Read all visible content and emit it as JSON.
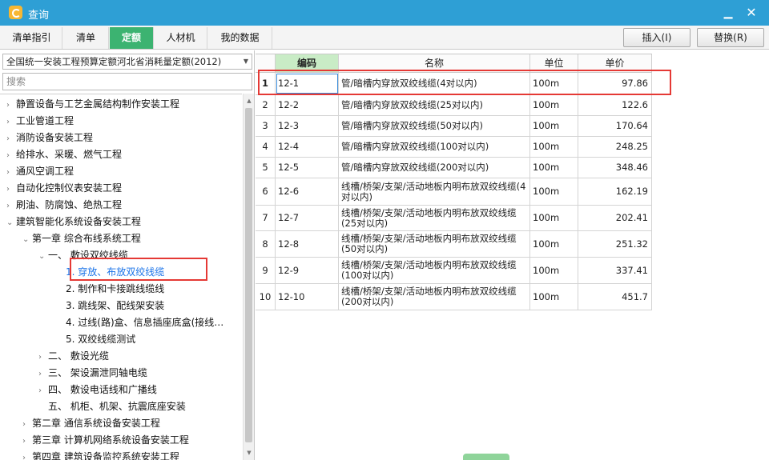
{
  "window": {
    "title": "查询"
  },
  "tabs": [
    {
      "label": "清单指引",
      "active": false
    },
    {
      "label": "清单",
      "active": false
    },
    {
      "label": "定额",
      "active": true
    },
    {
      "label": "人材机",
      "active": false
    },
    {
      "label": "我的数据",
      "active": false
    }
  ],
  "toolbar": {
    "insert_label": "插入(I)",
    "replace_label": "替换(R)"
  },
  "left": {
    "quota_book": "全国统一安装工程预算定额河北省消耗量定额(2012)",
    "search_placeholder": "搜索",
    "tree": [
      {
        "label": "静置设备与工艺金属结构制作安装工程",
        "toggle": "›"
      },
      {
        "label": "工业管道工程",
        "toggle": "›"
      },
      {
        "label": "消防设备安装工程",
        "toggle": "›"
      },
      {
        "label": "给排水、采暖、燃气工程",
        "toggle": "›"
      },
      {
        "label": "通风空调工程",
        "toggle": "›"
      },
      {
        "label": "自动化控制仪表安装工程",
        "toggle": "›"
      },
      {
        "label": "刷油、防腐蚀、绝热工程",
        "toggle": "›"
      },
      {
        "label": "建筑智能化系统设备安装工程",
        "toggle": "⌄"
      },
      {
        "label": "第一章 综合布线系统工程",
        "toggle": "⌄"
      },
      {
        "label": "一、 敷设双绞线缆",
        "toggle": "⌄"
      },
      {
        "label": "1. 穿放、布放双绞线缆",
        "toggle": "",
        "selected": true
      },
      {
        "label": "2. 制作和卡接跳线缆线",
        "toggle": ""
      },
      {
        "label": "3. 跳线架、配线架安装",
        "toggle": ""
      },
      {
        "label": "4. 过线(路)盒、信息插座底盒(接线…",
        "toggle": ""
      },
      {
        "label": "5. 双绞线缆测试",
        "toggle": ""
      },
      {
        "label": "二、 敷设光缆",
        "toggle": "›"
      },
      {
        "label": "三、 架设漏泄同轴电缆",
        "toggle": "›"
      },
      {
        "label": "四、 敷设电话线和广播线",
        "toggle": "›"
      },
      {
        "label": "五、 机柜、机架、抗震底座安装",
        "toggle": ""
      },
      {
        "label": "第二章 通信系统设备安装工程",
        "toggle": "›"
      },
      {
        "label": "第三章 计算机网络系统设备安装工程",
        "toggle": "›"
      },
      {
        "label": "第四章 建筑设备监控系统安装工程",
        "toggle": "›"
      }
    ]
  },
  "grid": {
    "headers": {
      "code": "编码",
      "name": "名称",
      "unit": "单位",
      "price": "单价"
    },
    "rows": [
      {
        "num": "1",
        "code": "12-1",
        "name": "管/暗槽内穿放双绞线缆(4对以内)",
        "unit": "100m",
        "price": "97.86"
      },
      {
        "num": "2",
        "code": "12-2",
        "name": "管/暗槽内穿放双绞线缆(25对以内)",
        "unit": "100m",
        "price": "122.6"
      },
      {
        "num": "3",
        "code": "12-3",
        "name": "管/暗槽内穿放双绞线缆(50对以内)",
        "unit": "100m",
        "price": "170.64"
      },
      {
        "num": "4",
        "code": "12-4",
        "name": "管/暗槽内穿放双绞线缆(100对以内)",
        "unit": "100m",
        "price": "248.25"
      },
      {
        "num": "5",
        "code": "12-5",
        "name": "管/暗槽内穿放双绞线缆(200对以内)",
        "unit": "100m",
        "price": "348.46"
      },
      {
        "num": "6",
        "code": "12-6",
        "name": "线槽/桥架/支架/活动地板内明布放双绞线缆(4对以内)",
        "unit": "100m",
        "price": "162.19"
      },
      {
        "num": "7",
        "code": "12-7",
        "name": "线槽/桥架/支架/活动地板内明布放双绞线缆(25对以内)",
        "unit": "100m",
        "price": "202.41"
      },
      {
        "num": "8",
        "code": "12-8",
        "name": "线槽/桥架/支架/活动地板内明布放双绞线缆(50对以内)",
        "unit": "100m",
        "price": "251.32"
      },
      {
        "num": "9",
        "code": "12-9",
        "name": "线槽/桥架/支架/活动地板内明布放双绞线缆(100对以内)",
        "unit": "100m",
        "price": "337.41"
      },
      {
        "num": "10",
        "code": "12-10",
        "name": "线槽/桥架/支架/活动地板内明布放双绞线缆(200对以内)",
        "unit": "100m",
        "price": "451.7"
      }
    ]
  }
}
